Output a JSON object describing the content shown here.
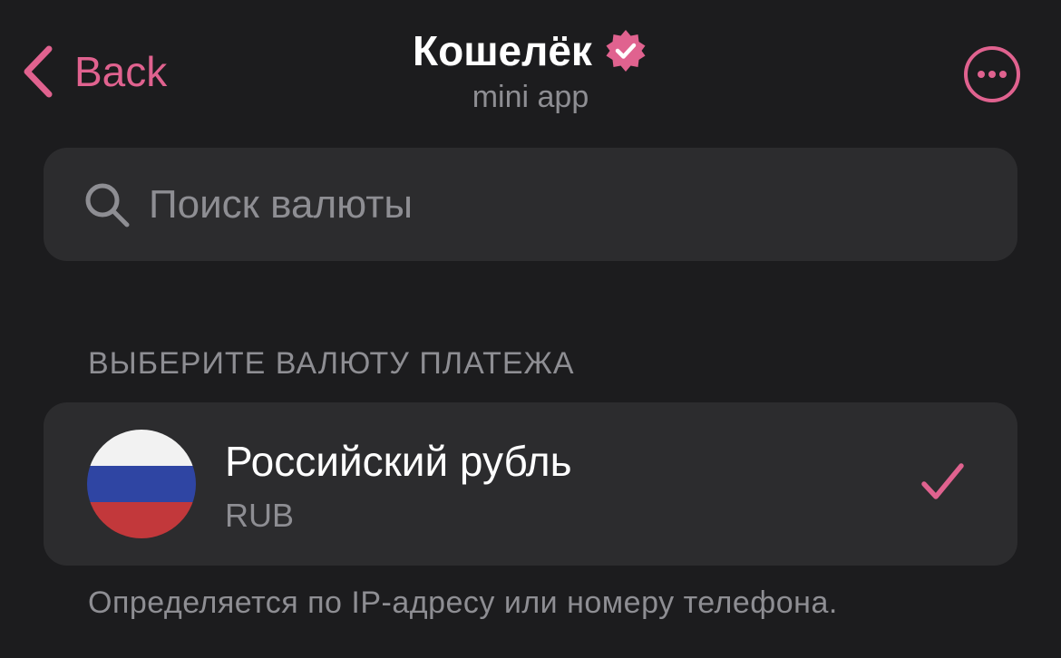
{
  "colors": {
    "accent": "#e0628f",
    "background": "#1c1c1e",
    "card": "#2c2c2e",
    "secondary_text": "#8e8e93",
    "flag_white": "#f2f2f2",
    "flag_blue": "#2f45a3",
    "flag_red": "#c2383b"
  },
  "header": {
    "back_label": "Back",
    "back_icon": "chevron-left-icon",
    "title": "Кошелёк",
    "verified_icon": "verified-badge-icon",
    "subtitle": "mini app",
    "more_icon": "more-circle-icon"
  },
  "search": {
    "placeholder": "Поиск валюты",
    "value": "",
    "icon": "search-icon"
  },
  "section": {
    "header": "ВЫБЕРИТЕ ВАЛЮТУ ПЛАТЕЖА",
    "items": [
      {
        "name": "Российский рубль",
        "code": "RUB",
        "flag_icon": "russia-flag-icon",
        "selected": true
      }
    ],
    "footnote": "Определяется по IP-адресу или номеру телефона."
  }
}
